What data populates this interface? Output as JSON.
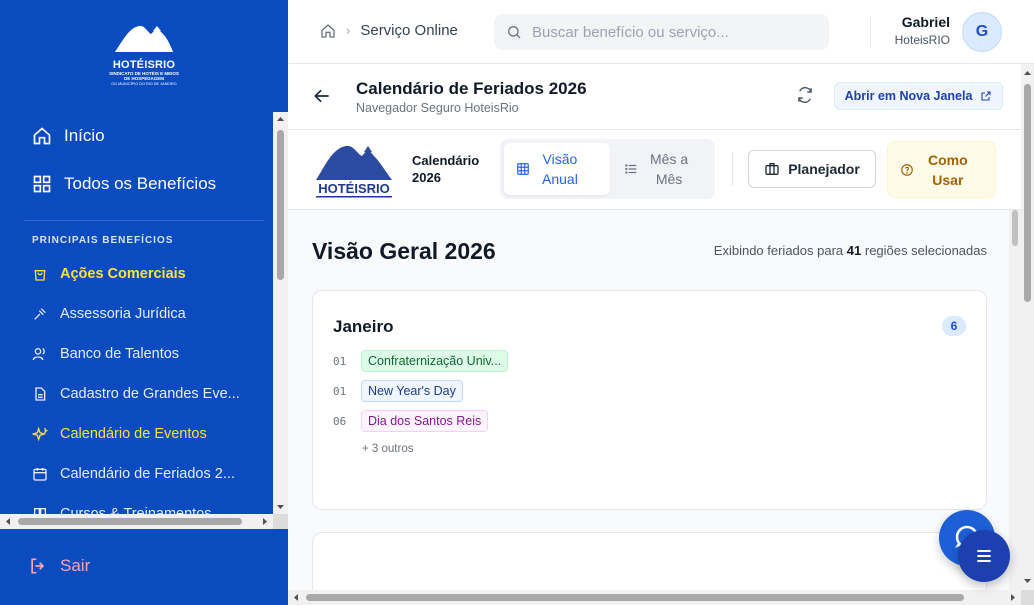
{
  "sidebar": {
    "logo": {
      "name": "HOTÉISRIO",
      "sub": "SINDICATO DE HOTÉIS E MEIOS DE HOSPEDAGEM",
      "sub2": "DO MUNICÍPIO DO RIO DE JANEIRO"
    },
    "main_items": [
      {
        "label": "Início",
        "icon": "home-icon"
      },
      {
        "label": "Todos os Benefícios",
        "icon": "grid-icon"
      }
    ],
    "section_title": "PRINCIPAIS BENEFÍCIOS",
    "items": [
      {
        "label": "Ações Comerciais",
        "icon": "shopping-bag-icon",
        "state": "active"
      },
      {
        "label": "Assessoria Jurídica",
        "icon": "gavel-icon"
      },
      {
        "label": "Banco de Talentos",
        "icon": "users-icon"
      },
      {
        "label": "Cadastro de Grandes Eve...",
        "icon": "document-icon"
      },
      {
        "label": "Calendário de Eventos",
        "icon": "sparkles-icon",
        "state": "highlight"
      },
      {
        "label": "Calendário de Feriados 2...",
        "icon": "calendar-icon"
      },
      {
        "label": "Cursos & Treinamentos",
        "icon": "book-icon"
      }
    ],
    "logout": "Sair"
  },
  "topbar": {
    "breadcrumb": "Serviço Online",
    "search_placeholder": "Buscar benefício ou serviço...",
    "user_name": "Gabriel",
    "user_org": "HoteisRIO",
    "avatar_initial": "G"
  },
  "page": {
    "title": "Calendário de Feriados 2026",
    "subtitle": "Navegador Seguro HoteisRio",
    "open_new_window": "Abrir em Nova Janela"
  },
  "toolbar": {
    "logo_text": "HOTÉISRIO",
    "title_line1": "Calendário",
    "title_line2": "2026",
    "view_annual_line1": "Visão",
    "view_annual_line2": "Anual",
    "view_month_line1": "Mês a",
    "view_month_line2": "Mês",
    "planner": "Planejador",
    "howto_line1": "Como",
    "howto_line2": "Usar"
  },
  "overview": {
    "title": "Visão Geral 2026",
    "info_prefix": "Exibindo feriados para",
    "region_count": "41",
    "info_suffix": "regiões selecionadas"
  },
  "months": [
    {
      "name": "Janeiro",
      "count": "6",
      "holidays": [
        {
          "day": "01",
          "name": "Confraternização Univ...",
          "color": "green"
        },
        {
          "day": "01",
          "name": "New Year's Day",
          "color": "blue"
        },
        {
          "day": "06",
          "name": "Dia dos Santos Reis",
          "color": "purple"
        }
      ],
      "more": "+ 3 outros"
    }
  ],
  "colors": {
    "sidebar_bg": "#0a4bc0",
    "active_item": "#fde047",
    "accent": "#2563eb",
    "logout": "#fda4af"
  }
}
